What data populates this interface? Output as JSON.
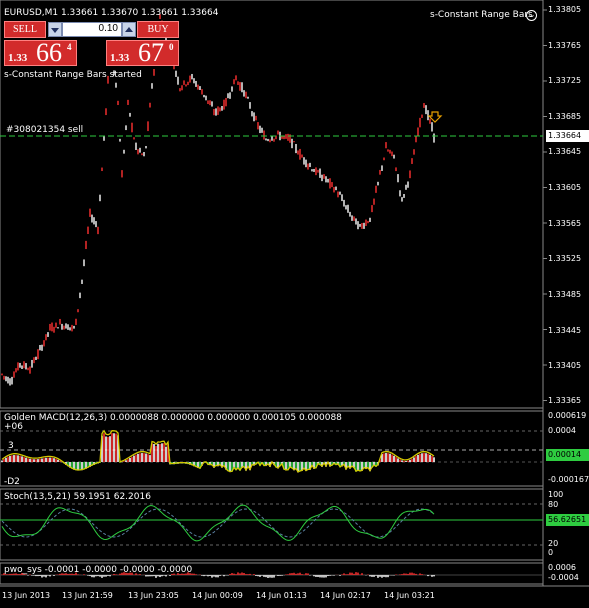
{
  "symbol_header": "EURUSD,M1  1.33661  1.33670  1.33661  1.33664",
  "expert_name": "s-Constant Range Bars",
  "expert_started_msg": "s-Constant Range Bars started",
  "order_label": "#308021354 sell",
  "trade_panel": {
    "sell_label": "SELL",
    "buy_label": "BUY",
    "volume": "0.10",
    "sell_price": {
      "prefix": "1.33",
      "big": "66",
      "sup": "4"
    },
    "buy_price": {
      "prefix": "1.33",
      "big": "67",
      "sup": "0"
    }
  },
  "price_axis": {
    "labels": [
      "1.33805",
      "1.33765",
      "1.33725",
      "1.33685",
      "1.33645",
      "1.33605",
      "1.33565",
      "1.33525",
      "1.33485",
      "1.33445",
      "1.33405",
      "1.33365"
    ],
    "current_price": "1.33664"
  },
  "macd_panel": {
    "title": "Golden MACD(12,26,3) 0.0000088 0.000000 0.000000 0.000105 0.000088",
    "left_top_label": "+06",
    "left_mid_label": "3",
    "left_bottom_label": "-D2",
    "axis_labels": [
      "0.000619",
      "0.0004",
      "0.000167"
    ],
    "current_value": "0.00014",
    "bottom_value": "-0.000167"
  },
  "stoch_panel": {
    "title": "Stoch(13,5,21) 59.1951 62.2016",
    "axis_labels": [
      "100",
      "80",
      "20",
      "0"
    ],
    "current_value": "56.62651"
  },
  "pwo_panel": {
    "title": "pwo_sys -0.0001 -0.0000 -0.0000 -0.0000",
    "axis_labels": [
      "0.0006",
      "-0.0004"
    ]
  },
  "time_axis": [
    "13 Jun 2013",
    "13 Jun 21:59",
    "13 Jun 23:05",
    "14 Jun 00:09",
    "14 Jun 01:13",
    "14 Jun 02:17",
    "14 Jun 03:21"
  ],
  "colors": {
    "bull": "#ff3030",
    "bear": "#ffffff",
    "sell_button": "#d22b2b",
    "macd_pos": "#ff3030",
    "macd_neg": "#2ecc40",
    "macd_line": "#d4c800",
    "stoch_main": "#2ecc40",
    "stoch_signal": "#5a7fa0",
    "current_tag": "#2ecc40"
  }
}
